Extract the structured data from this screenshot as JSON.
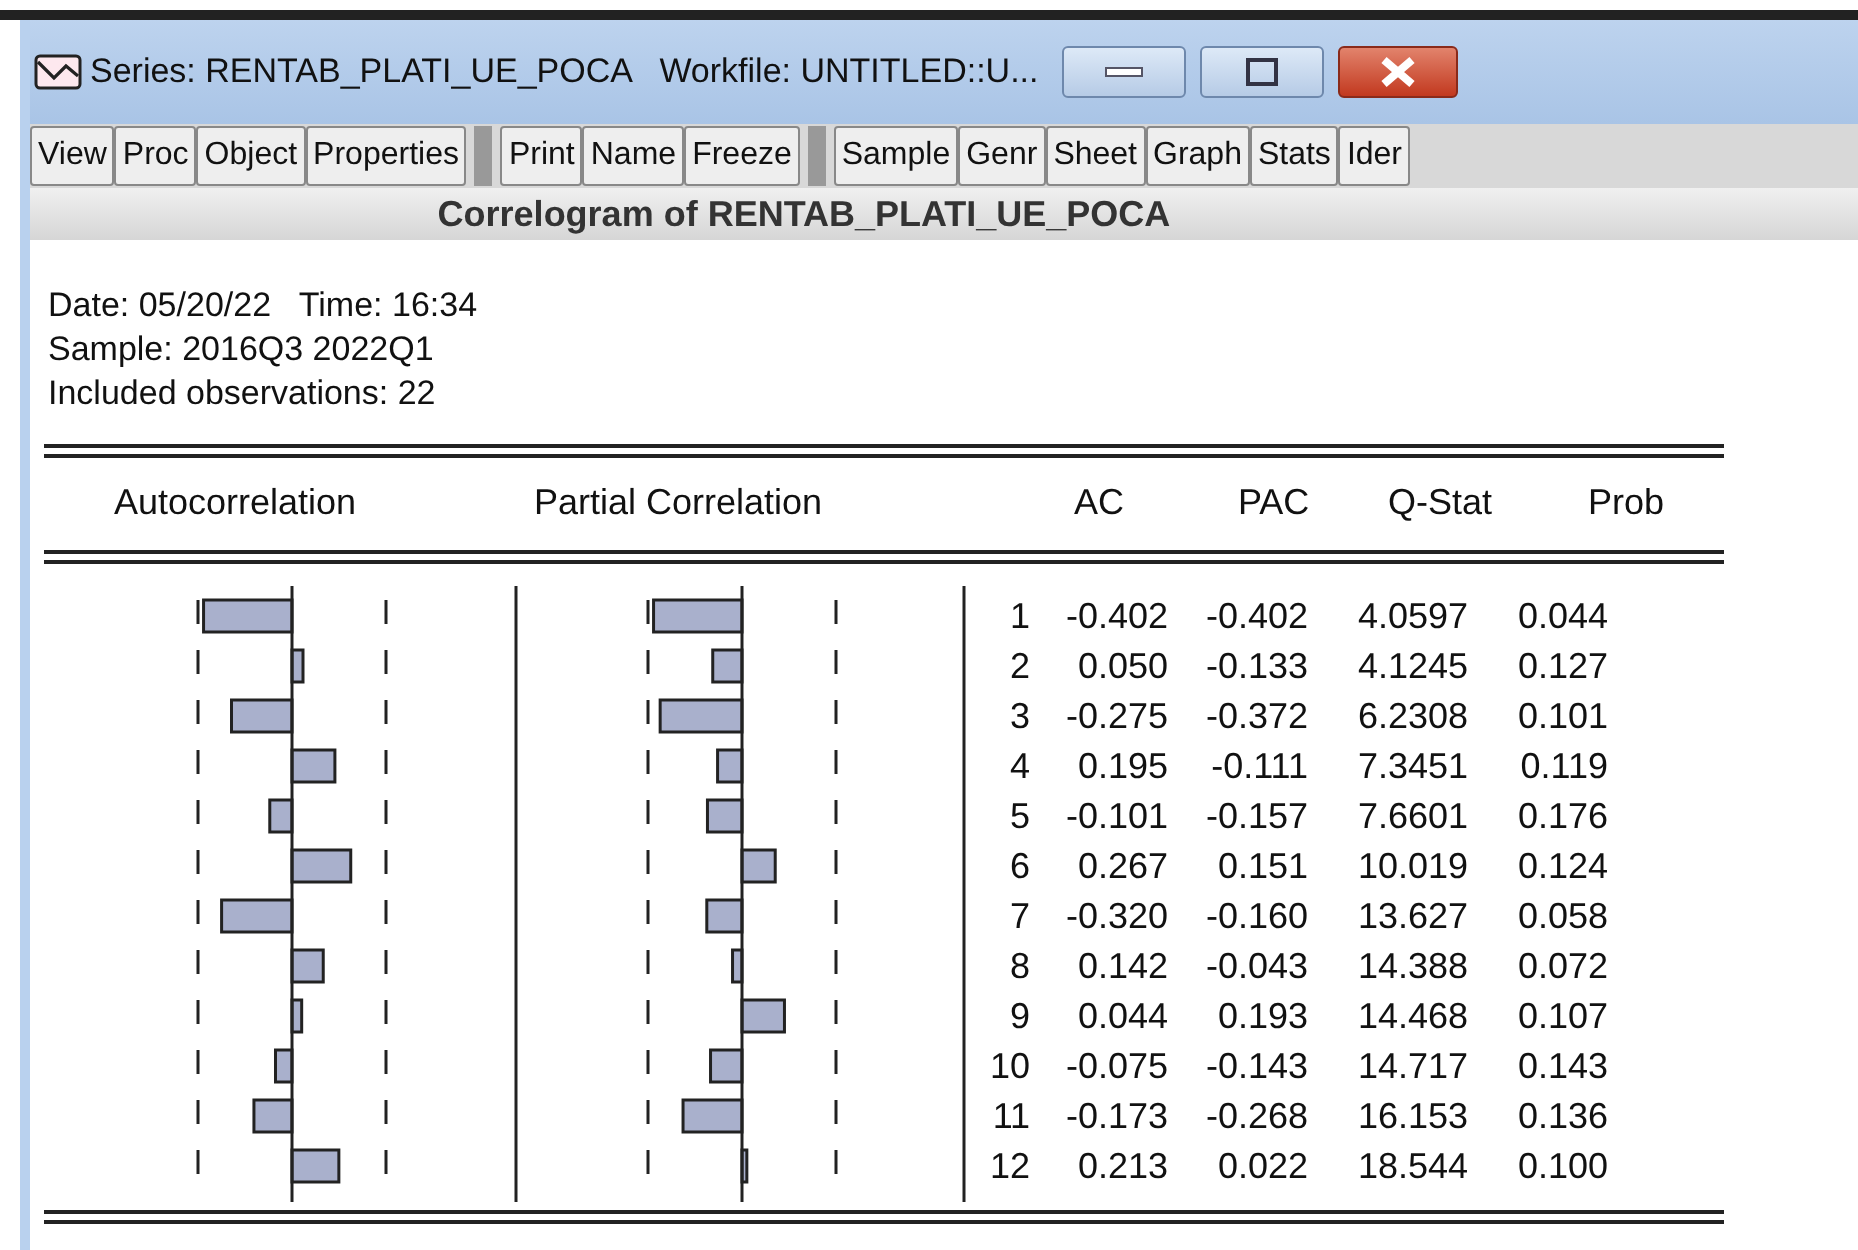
{
  "window": {
    "title": "Series: RENTAB_PLATI_UE_POCA   Workfile: UNTITLED::U..."
  },
  "toolbar": [
    [
      "View",
      "Proc",
      "Object",
      "Properties"
    ],
    [
      "Print",
      "Name",
      "Freeze"
    ],
    [
      "Sample",
      "Genr",
      "Sheet",
      "Graph",
      "Stats",
      "Ider"
    ]
  ],
  "heading": "Correlogram of RENTAB_PLATI_UE_POCA",
  "info": [
    "Date: 05/20/22   Time: 16:34",
    "Sample: 2016Q3 2022Q1",
    "Included observations: 22"
  ],
  "columns": [
    "Autocorrelation",
    "Partial Correlation",
    "AC",
    "PAC",
    "Q-Stat",
    "Prob"
  ],
  "rows": [
    {
      "lag": "1",
      "ac": "-0.402",
      "pac": "-0.402",
      "q": "4.0597",
      "prob": "0.044"
    },
    {
      "lag": "2",
      "ac": "0.050",
      "pac": "-0.133",
      "q": "4.1245",
      "prob": "0.127"
    },
    {
      "lag": "3",
      "ac": "-0.275",
      "pac": "-0.372",
      "q": "6.2308",
      "prob": "0.101"
    },
    {
      "lag": "4",
      "ac": "0.195",
      "pac": "-0.111",
      "q": "7.3451",
      "prob": "0.119"
    },
    {
      "lag": "5",
      "ac": "-0.101",
      "pac": "-0.157",
      "q": "7.6601",
      "prob": "0.176"
    },
    {
      "lag": "6",
      "ac": "0.267",
      "pac": "0.151",
      "q": "10.019",
      "prob": "0.124"
    },
    {
      "lag": "7",
      "ac": "-0.320",
      "pac": "-0.160",
      "q": "13.627",
      "prob": "0.058"
    },
    {
      "lag": "8",
      "ac": "0.142",
      "pac": "-0.043",
      "q": "14.388",
      "prob": "0.072"
    },
    {
      "lag": "9",
      "ac": "0.044",
      "pac": "0.193",
      "q": "14.468",
      "prob": "0.107"
    },
    {
      "lag": "10",
      "ac": "-0.075",
      "pac": "-0.143",
      "q": "14.717",
      "prob": "0.143"
    },
    {
      "lag": "11",
      "ac": "-0.173",
      "pac": "-0.268",
      "q": "16.153",
      "prob": "0.136"
    },
    {
      "lag": "12",
      "ac": "0.213",
      "pac": "0.022",
      "q": "18.544",
      "prob": "0.100"
    }
  ]
}
